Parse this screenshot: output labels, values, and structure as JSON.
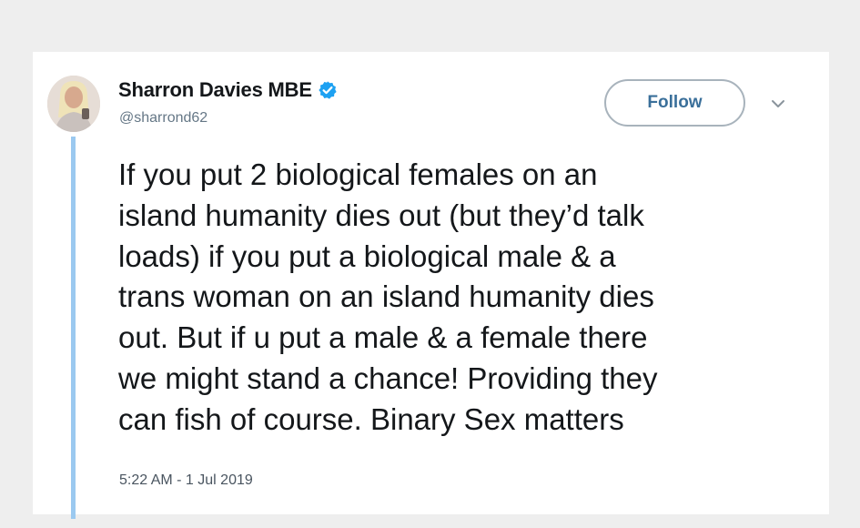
{
  "tweet": {
    "author_name": "Sharron Davies MBE",
    "handle": "@sharrond62",
    "follow_label": "Follow",
    "text": "If you put 2 biological females on an\nisland humanity dies out (but they’d talk\nloads) if you put a biological male & a\ntrans woman on an island humanity dies\nout. But if u put a male & a female there\nwe might stand a chance! Providing they\ncan fish of course. Binary Sex matters",
    "timestamp": "5:22 AM - 1 Jul 2019"
  },
  "icons": {
    "verified": "verified-badge-icon",
    "more": "chevron-down-icon"
  },
  "colors": {
    "verified_blue": "#1da1f2",
    "thread_line": "#9bc9f0",
    "follow_text": "#3a6f9a",
    "text_primary": "#14171a",
    "text_secondary": "#657786"
  }
}
